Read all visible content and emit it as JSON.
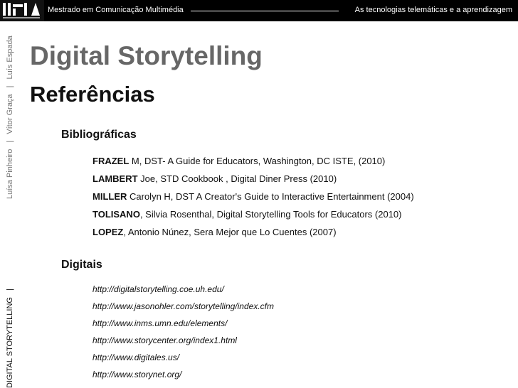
{
  "header": {
    "logo_alt": "logo",
    "left_text": "Mestrado em Comunicação Multimédia",
    "right_text": "As tecnologias telemáticas e a aprendizagem"
  },
  "side": {
    "authors": [
      "Luísa Pinheiro",
      "Vítor Graça",
      "Luís Espada"
    ],
    "separator": "|",
    "course": "DIGITAL STORYTELLING"
  },
  "main": {
    "title": "Digital Storytelling",
    "subtitle": "Referências",
    "bibliographic_heading": "Bibliográficas",
    "bibliography": [
      {
        "author": "FRAZEL",
        "rest": " M, DST- A Guide for Educators, Washington, DC ISTE, (2010)"
      },
      {
        "author": "LAMBERT",
        "rest": " Joe, STD Cookbook , Digital Diner Press (2010)"
      },
      {
        "author": "MILLER",
        "rest": " Carolyn H, DST A Creator's Guide to Interactive Entertainment (2004)"
      },
      {
        "author": "TOLISANO",
        "rest": ", Silvia Rosenthal, Digital Storytelling Tools for Educators (2010)"
      },
      {
        "author": "LOPEZ",
        "rest": ", Antonio Núnez, Sera Mejor que Lo Cuentes (2007)"
      }
    ],
    "digital_heading": "Digitais",
    "links": [
      "http://digitalstorytelling.coe.uh.edu/",
      "http://www.jasonohler.com/storytelling/index.cfm",
      "http://www.inms.umn.edu/elements/",
      "http://www.storycenter.org/index1.html",
      "http://www.digitales.us/",
      "http://www.storynet.org/"
    ]
  }
}
